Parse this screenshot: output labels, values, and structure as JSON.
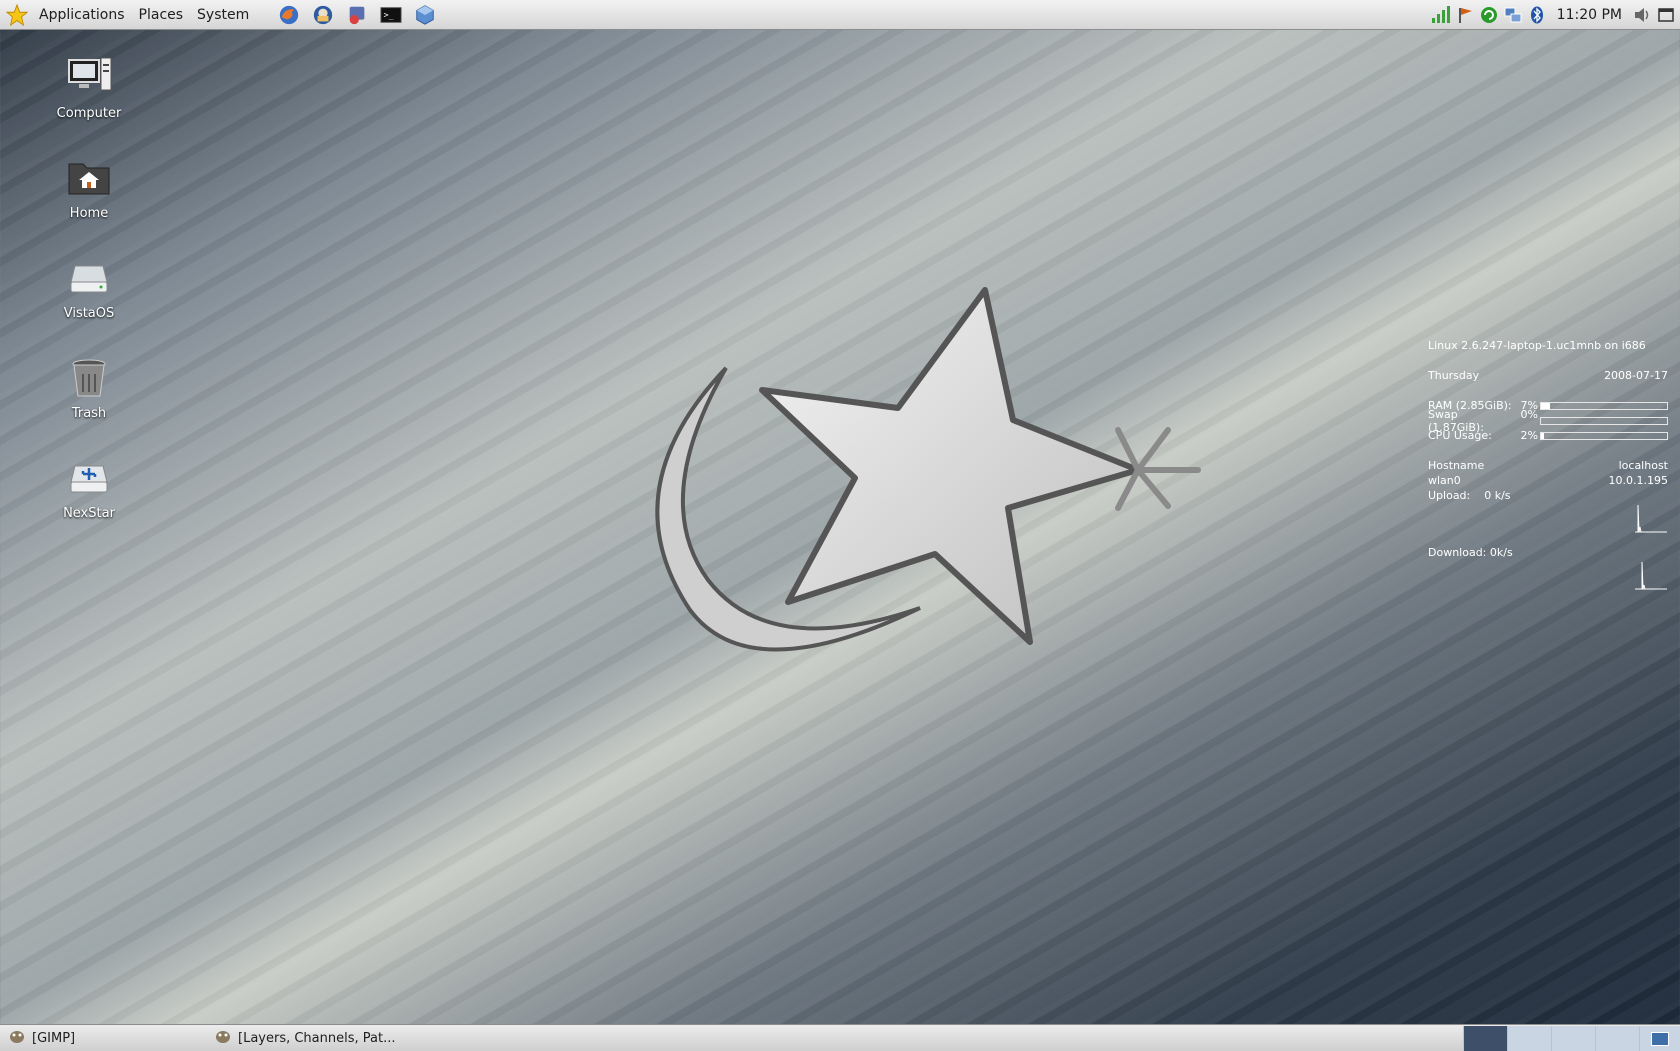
{
  "top_panel": {
    "menus": [
      "Applications",
      "Places",
      "System"
    ],
    "launchers": [
      "firefox-icon",
      "thunderbird-icon",
      "pidgin-icon",
      "terminal-icon",
      "virtualbox-icon"
    ],
    "clock": "11:20 PM"
  },
  "desktop_icons": [
    {
      "label": "Computer",
      "icon": "computer-icon"
    },
    {
      "label": "Home",
      "icon": "home-folder-icon"
    },
    {
      "label": "VistaOS",
      "icon": "drive-icon"
    },
    {
      "label": "Trash",
      "icon": "trash-icon"
    },
    {
      "label": "NexStar",
      "icon": "usb-drive-icon"
    }
  ],
  "conky": {
    "kernel": "Linux 2.6.247-laptop-1.uc1mnb on i686",
    "day": "Thursday",
    "date": "2008-07-17",
    "ram_label": "RAM (2.85GiB):",
    "ram_pct": "7%",
    "ram_fraction": 0.07,
    "swap_label": "Swap (1.87GiB):",
    "swap_pct": "0%",
    "swap_fraction": 0.0,
    "cpu_label": "CPU Usage:",
    "cpu_pct": "2%",
    "cpu_fraction": 0.02,
    "hostname_label": "Hostname",
    "hostname": "localhost",
    "iface": "wlan0",
    "ip": "10.0.1.195",
    "upload": "Upload:    0 k/s",
    "download": "Download: 0k/s"
  },
  "bottom_panel": {
    "tasks": [
      {
        "label": "[GIMP]",
        "icon": "gimp-icon"
      },
      {
        "label": "[Layers, Channels, Pat...",
        "icon": "gimp-icon"
      }
    ]
  },
  "colors": {
    "accent": "#3e4f6a",
    "panel": "#e0e0e0"
  }
}
